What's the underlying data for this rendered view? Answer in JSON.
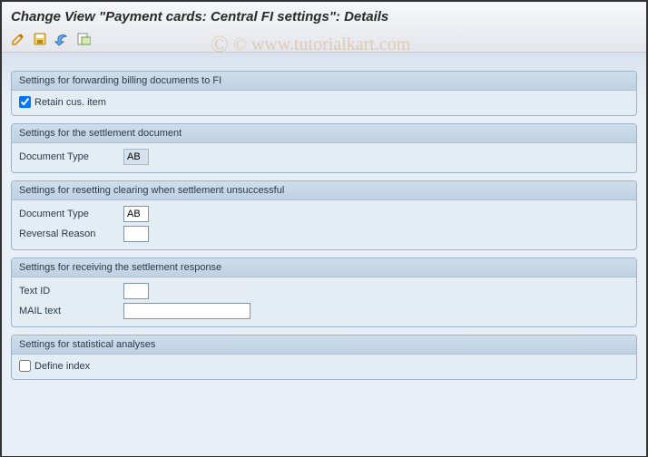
{
  "title": "Change View \"Payment cards: Central FI settings\": Details",
  "watermark": "© www.tutorialkart.com",
  "toolbar": {
    "icons": [
      "edit-icon",
      "save-icon",
      "back-icon",
      "change-icon"
    ]
  },
  "groups": {
    "forwarding": {
      "header": "Settings for forwarding billing documents to FI",
      "retain_label": "Retain cus. item",
      "retain_checked": true
    },
    "settlement_doc": {
      "header": "Settings for the settlement document",
      "doctype_label": "Document Type",
      "doctype_value": "AB"
    },
    "reset_clearing": {
      "header": "Settings for resetting clearing when settlement unsuccessful",
      "doctype_label": "Document Type",
      "doctype_value": "AB",
      "reversal_label": "Reversal Reason",
      "reversal_value": ""
    },
    "settlement_response": {
      "header": "Settings for receiving the settlement response",
      "textid_label": "Text ID",
      "textid_value": "",
      "mail_label": "MAIL text",
      "mail_value": ""
    },
    "statistical": {
      "header": "Settings for statistical analyses",
      "define_index_label": "Define index",
      "define_index_checked": false
    }
  }
}
